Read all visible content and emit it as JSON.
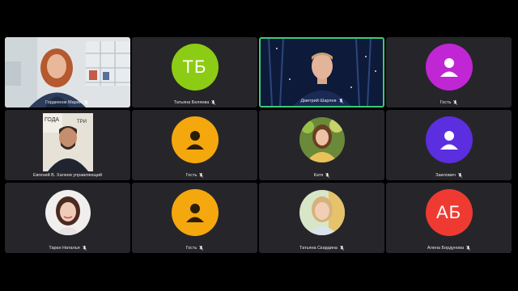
{
  "participants": [
    {
      "name": "Гордеенок Мария",
      "type": "video"
    },
    {
      "name": "Татьяна Беляева",
      "type": "initials",
      "initials": "ТБ",
      "color": "#8dcc14"
    },
    {
      "name": "Дмитрий Шарлев",
      "type": "video",
      "speaking": true
    },
    {
      "name": "Гость",
      "type": "guest",
      "color": "#c026d3"
    },
    {
      "name": "Евгений В. Халеев управляющий",
      "type": "photo-rect"
    },
    {
      "name": "Гость",
      "type": "guest",
      "color": "#f5a70e"
    },
    {
      "name": "Катя",
      "type": "photo"
    },
    {
      "name": "Заилович",
      "type": "guest",
      "color": "#5b2ee0"
    },
    {
      "name": "Таран Наталья",
      "type": "photo"
    },
    {
      "name": "Гость",
      "type": "guest",
      "color": "#f5a70e"
    },
    {
      "name": "Татьяна Скардина",
      "type": "photo"
    },
    {
      "name": "Алена Бордунова",
      "type": "initials",
      "initials": "АБ",
      "color": "#ef3a32"
    }
  ],
  "icons": {
    "muted": "mic-off-icon",
    "guest": "person-icon"
  },
  "colors": {
    "active_border": "#3ec97a",
    "tile_bg": "#26262a"
  }
}
